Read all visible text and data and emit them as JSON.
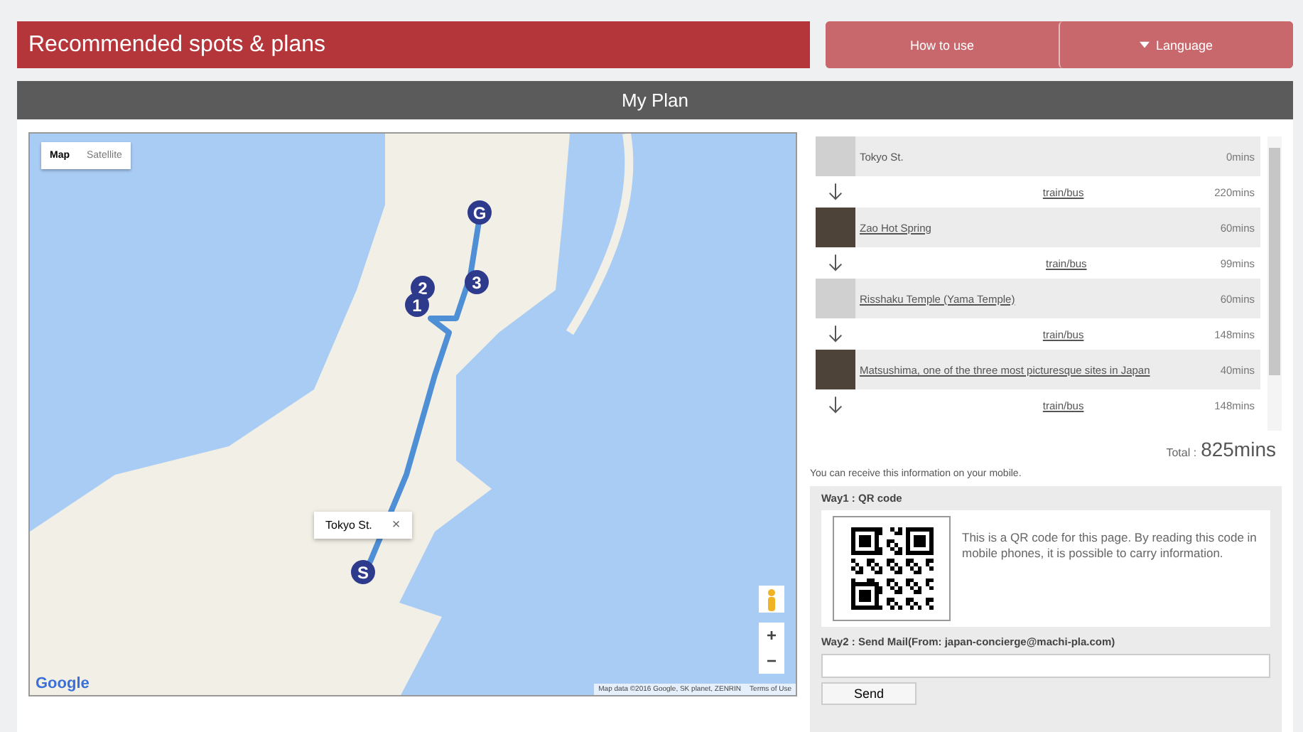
{
  "header": {
    "title": "Recommended spots & plans",
    "buttons": [
      {
        "label": "How to use",
        "dropdown": false
      },
      {
        "label": "Language",
        "dropdown": true
      }
    ]
  },
  "section_title": "My Plan",
  "map": {
    "type_buttons": [
      {
        "label": "Map",
        "selected": true
      },
      {
        "label": "Satellite",
        "selected": false
      }
    ],
    "markers": [
      {
        "label": "G"
      },
      {
        "label": "2"
      },
      {
        "label": "3"
      },
      {
        "label": "1"
      },
      {
        "label": "S"
      }
    ],
    "popup": {
      "text": "Tokyo St.",
      "close": "×"
    },
    "zoom_in": "+",
    "zoom_out": "−",
    "logo": "Google",
    "attribution": "Map data ©2016 Google, SK planet, ZENRIN",
    "terms": "Terms of Use"
  },
  "plan": [
    {
      "kind": "spot",
      "name": "Tokyo St.",
      "linked": false,
      "duration": "0mins"
    },
    {
      "kind": "transport",
      "name": "train/bus",
      "duration": "220mins"
    },
    {
      "kind": "spot",
      "name": "Zao Hot Spring",
      "linked": true,
      "duration": "60mins"
    },
    {
      "kind": "transport",
      "name": "train/bus",
      "duration": "99mins"
    },
    {
      "kind": "spot",
      "name": "Risshaku Temple (Yama Temple)",
      "linked": true,
      "duration": "60mins"
    },
    {
      "kind": "transport",
      "name": "train/bus",
      "duration": "148mins"
    },
    {
      "kind": "spot",
      "name": "Matsushima, one of the three most picturesque sites in Japan",
      "linked": true,
      "duration": "40mins"
    },
    {
      "kind": "transport",
      "name": "train/bus",
      "duration": "148mins"
    }
  ],
  "total": {
    "label": "Total :",
    "value": "825mins"
  },
  "mobile_note": "You can receive this information on your mobile.",
  "way1": {
    "title": "Way1 : QR code",
    "text": "This is a QR code for this page. By reading this code in mobile phones, it is possible to carry information."
  },
  "way2": {
    "title": "Way2 : Send Mail(From: japan-concierge@machi-pla.com)",
    "button": "Send"
  }
}
